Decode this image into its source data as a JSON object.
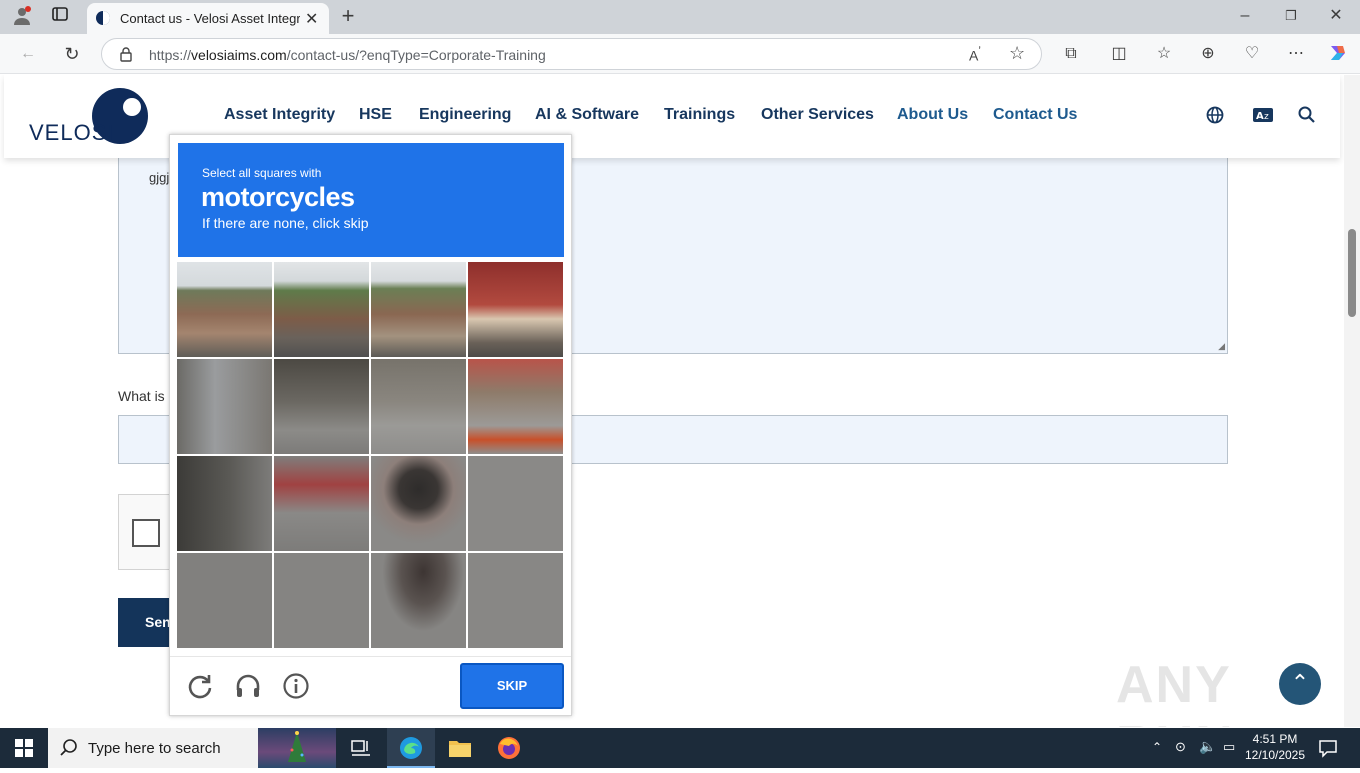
{
  "browser": {
    "tab_title": "Contact us - Velosi Asset Integrity",
    "url_prefix": "https://",
    "url_domain": "velosiaims.com",
    "url_path": "/contact-us/?enqType=Corporate-Training"
  },
  "site": {
    "logo_text": "VELOSI",
    "nav": [
      "Asset Integrity",
      "HSE",
      "Engineering",
      "AI & Software",
      "Trainings",
      "Other Services",
      "About Us",
      "Contact Us"
    ]
  },
  "form": {
    "textarea_value": "gjgj",
    "question_label": "What is",
    "send_label": "Sen"
  },
  "captcha": {
    "prompt": "Select all squares with",
    "target": "motorcycles",
    "subtitle": "If there are none, click skip",
    "skip_label": "SKIP"
  },
  "watermark": "ANY RUN",
  "taskbar": {
    "search_placeholder": "Type here to search",
    "time": "4:51 PM",
    "date": "12/10/2025"
  },
  "colors": {
    "nav": "#17375e",
    "captcha_blue": "#1f73e8",
    "send_button": "#14345a"
  }
}
